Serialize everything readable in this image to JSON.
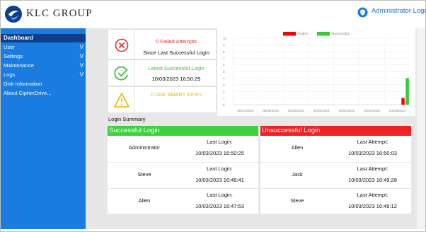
{
  "brand": {
    "name": "KLC GROUP"
  },
  "user": {
    "name": "Administrator",
    "logout": "Logout"
  },
  "sidebar": {
    "items": [
      {
        "label": "Dashboard",
        "active": true,
        "chevron": false
      },
      {
        "label": "User",
        "chevron": true
      },
      {
        "label": "Settings",
        "chevron": true
      },
      {
        "label": "Maintenance",
        "chevron": true
      },
      {
        "label": "Logs",
        "chevron": true
      },
      {
        "label": "Disk Information",
        "chevron": false
      },
      {
        "label": "About CipherDrive...",
        "chevron": false
      }
    ],
    "chevron_glyph": "V"
  },
  "stats": {
    "failed": {
      "line1": "0 Failed Attempts",
      "line2": "Since Last Successful Login",
      "icon": "x-circle-icon",
      "color": "#e03030"
    },
    "latest": {
      "line1": "Latest Successful Login",
      "line2": "10/03/2023 16:50:25",
      "icon": "check-circle-icon",
      "color": "#3fbf3f"
    },
    "smart": {
      "line1": "0 Disk SMART Errors",
      "icon": "warning-triangle-icon",
      "color": "#e6b800"
    }
  },
  "chart_data": {
    "type": "bar",
    "categories": [
      "05/27/2023",
      "05/28/2023",
      "05/29/2023",
      "05/30/2023",
      "10/01/2023",
      "10/02/2023",
      "10/03/2023"
    ],
    "series": [
      {
        "name": "Failed",
        "color": "#ff0000",
        "values": [
          0,
          0,
          0,
          0,
          0,
          0,
          1
        ]
      },
      {
        "name": "Successful",
        "color": "#33cc33",
        "values": [
          0,
          0,
          0,
          0,
          0,
          0,
          4
        ]
      }
    ],
    "y_ticks": [
      "0",
      "1",
      "2",
      "3",
      "4",
      "5",
      "6",
      "7",
      "8",
      "9",
      "10"
    ],
    "ylim": [
      0,
      10
    ],
    "legend_position": "top"
  },
  "summary": {
    "title": "Login Summary",
    "successful": {
      "heading": "Successful Login",
      "color": "#3fcf3f",
      "rows": [
        {
          "name": "Administrator",
          "label": "Last Login:",
          "time": "10/03/2023 16:50:25"
        },
        {
          "name": "Steve",
          "label": "Last Login:",
          "time": "10/03/2023 16:48:41"
        },
        {
          "name": "Allen",
          "label": "Last Login:",
          "time": "10/03/2023 16:47:53"
        }
      ]
    },
    "unsuccessful": {
      "heading": "Unsuccessful Login",
      "color": "#ee2222",
      "rows": [
        {
          "name": "Allen",
          "label": "Last Attempt:",
          "time": "10/03/2023 16:50:03"
        },
        {
          "name": "Jack",
          "label": "Last Attempt:",
          "time": "10/03/2023 16:49:28"
        },
        {
          "name": "Steve",
          "label": "Last Attempt:",
          "time": "10/03/2023 16:49:12"
        }
      ]
    }
  }
}
